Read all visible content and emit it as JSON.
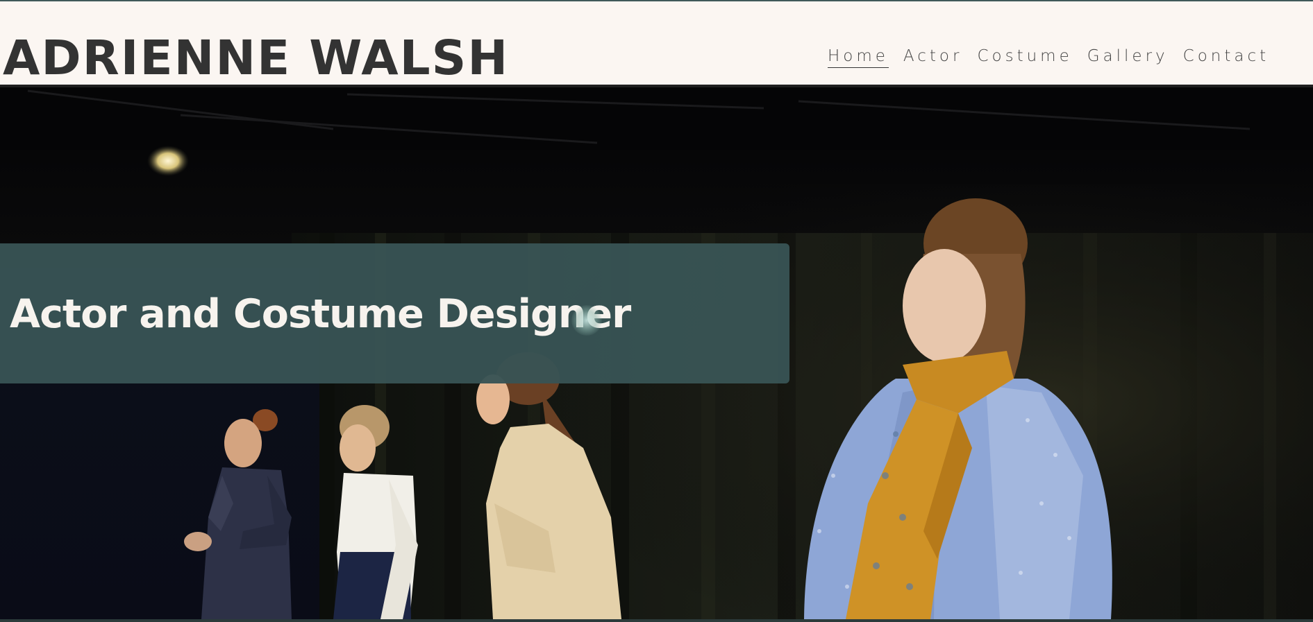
{
  "site": {
    "title": "ADRIENNE WALSH"
  },
  "nav": {
    "items": [
      {
        "label": "Home",
        "active": true
      },
      {
        "label": "Actor",
        "active": false
      },
      {
        "label": "Costume",
        "active": false
      },
      {
        "label": "Gallery",
        "active": false
      },
      {
        "label": "Contact",
        "active": false
      }
    ]
  },
  "hero": {
    "banner_title": "Actor and Costume Designer"
  },
  "colors": {
    "header_bg": "#fbf6f2",
    "title_text": "#333333",
    "banner_bg": "#385354",
    "banner_text": "#f7f3ee",
    "stage_bg": "#0b0b0d"
  }
}
